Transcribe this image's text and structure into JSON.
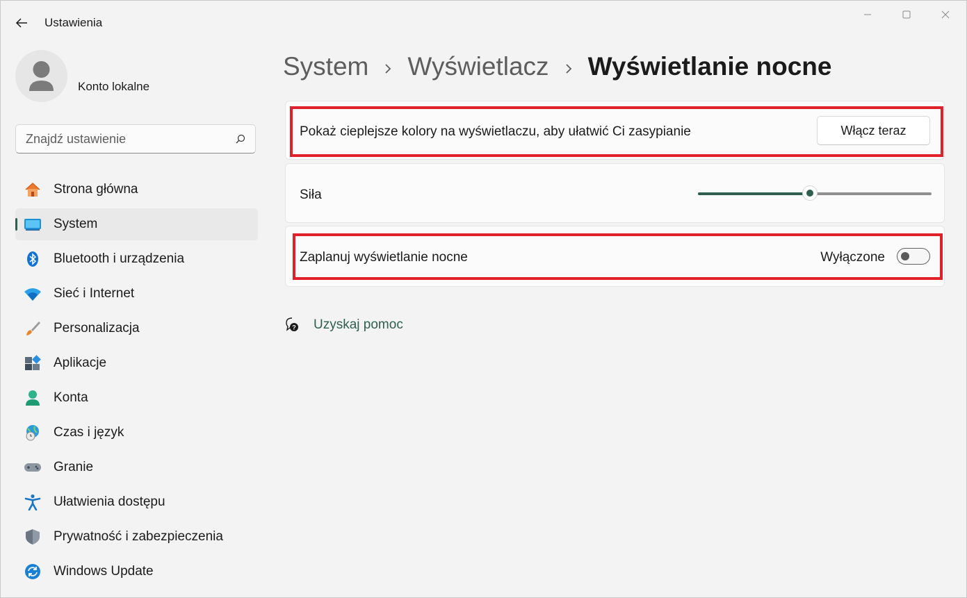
{
  "window": {
    "title": "Ustawienia",
    "controls": {
      "minimize": "minimize-icon",
      "maximize": "maximize-icon",
      "close": "close-icon"
    }
  },
  "account": {
    "name": "Konto lokalne",
    "avatar_icon": "user-avatar-icon"
  },
  "search": {
    "placeholder": "Znajdź ustawienie",
    "value": "",
    "icon": "search-icon"
  },
  "sidebar": {
    "items": [
      {
        "label": "Strona główna",
        "icon": "home-icon",
        "active": false
      },
      {
        "label": "System",
        "icon": "monitor-icon",
        "active": true
      },
      {
        "label": "Bluetooth i urządzenia",
        "icon": "bluetooth-icon",
        "active": false
      },
      {
        "label": "Sieć i Internet",
        "icon": "wifi-icon",
        "active": false
      },
      {
        "label": "Personalizacja",
        "icon": "brush-icon",
        "active": false
      },
      {
        "label": "Aplikacje",
        "icon": "apps-icon",
        "active": false
      },
      {
        "label": "Konta",
        "icon": "account-icon",
        "active": false
      },
      {
        "label": "Czas i język",
        "icon": "globe-clock-icon",
        "active": false
      },
      {
        "label": "Granie",
        "icon": "gamepad-icon",
        "active": false
      },
      {
        "label": "Ułatwienia dostępu",
        "icon": "accessibility-icon",
        "active": false
      },
      {
        "label": "Prywatność i zabezpieczenia",
        "icon": "shield-icon",
        "active": false
      },
      {
        "label": "Windows Update",
        "icon": "update-icon",
        "active": false
      }
    ]
  },
  "breadcrumb": {
    "items": [
      "System",
      "Wyświetlacz",
      "Wyświetlanie nocne"
    ],
    "separator": "›"
  },
  "cards": {
    "warm_colors": {
      "label": "Pokaż cieplejsze kolory na wyświetlaczu, aby ułatwić Ci zasypianie",
      "button_label": "Włącz teraz"
    },
    "strength": {
      "label": "Siła",
      "value": 0.48
    },
    "schedule": {
      "label": "Zaplanuj wyświetlanie nocne",
      "state_label": "Wyłączone",
      "on": false
    }
  },
  "help": {
    "label": "Uzyskaj pomoc",
    "icon": "help-icon"
  },
  "colors": {
    "accent": "#2f5f4f",
    "highlight": "#e0202a",
    "background": "#f3f3f3",
    "card": "#fbfbfb"
  }
}
